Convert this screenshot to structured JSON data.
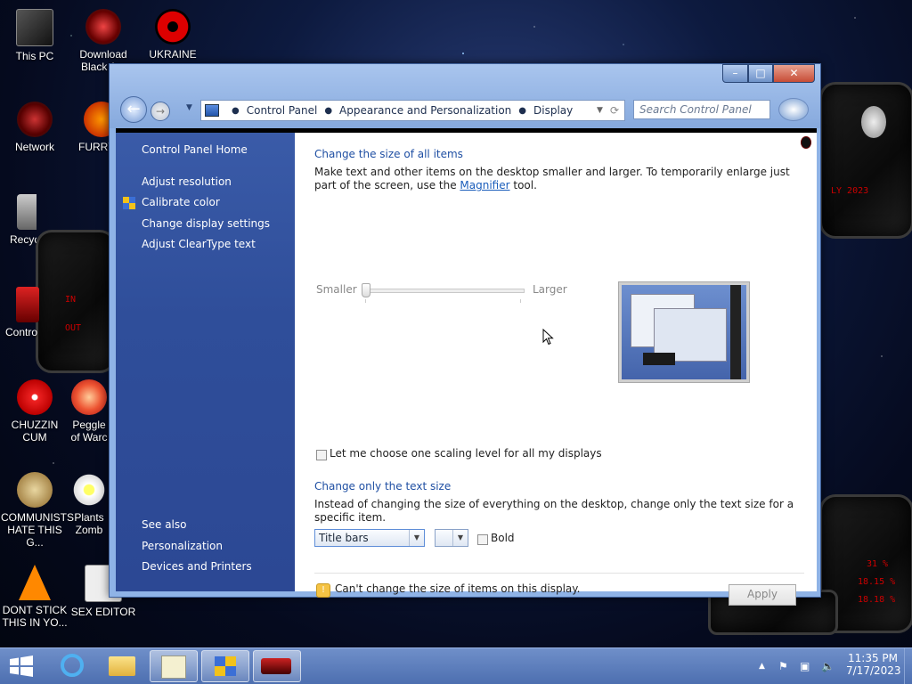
{
  "desktop": {
    "icons": [
      {
        "label": "This PC"
      },
      {
        "label": "Download Black A..."
      },
      {
        "label": "UKRAINE"
      },
      {
        "label": "Network"
      },
      {
        "label": "FURRY"
      },
      {
        "label": "Recyc"
      },
      {
        "label": "Contro"
      },
      {
        "label": "CHUZZIN CUM"
      },
      {
        "label": "Peggle of Warc"
      },
      {
        "label": "COMMUNISTS HATE THIS G..."
      },
      {
        "label": "Plants Zomb"
      },
      {
        "label": "DONT STICK THIS IN YO..."
      },
      {
        "label": "SEX EDITOR"
      }
    ],
    "panel_text": {
      "in": "IN",
      "out": "OUT",
      "ly": "LY 2023",
      "r1": "31 %",
      "r2": "18.15 %",
      "r3": "18.18 %"
    }
  },
  "window": {
    "buttons": {
      "minimize": "–",
      "maximize": "□",
      "close": "✕"
    },
    "breadcrumb": [
      "Control Panel",
      "Appearance and Personalization",
      "Display"
    ],
    "search_placeholder": "Search Control Panel"
  },
  "sidebar": {
    "home": "Control Panel Home",
    "links": [
      "Adjust resolution",
      "Calibrate color",
      "Change display settings",
      "Adjust ClearType text"
    ],
    "see_also": "See also",
    "see_also_links": [
      "Personalization",
      "Devices and Printers"
    ]
  },
  "content": {
    "heading1": "Change the size of all items",
    "desc1_before": "Make text and other items on the desktop smaller and larger. To temporarily enlarge just part of the screen, use the ",
    "desc1_link": "Magnifier",
    "desc1_after": " tool.",
    "slider": {
      "min_label": "Smaller",
      "max_label": "Larger",
      "value": 0
    },
    "scaling_checkbox": "Let me choose one scaling level for all my displays",
    "heading2": "Change only the text size",
    "desc2": "Instead of changing the size of everything on the desktop, change only the text size for a specific item.",
    "item_select": "Title bars",
    "size_select": "",
    "bold_label": "Bold",
    "warning": "Can't change the size of items on this display.",
    "apply": "Apply"
  },
  "taskbar": {
    "time": "11:35 PM",
    "date": "7/17/2023"
  },
  "colors": {
    "sidebar": "#2f4e9a",
    "link": "#1f4fa3",
    "taskbar": "#5b7cbd"
  }
}
